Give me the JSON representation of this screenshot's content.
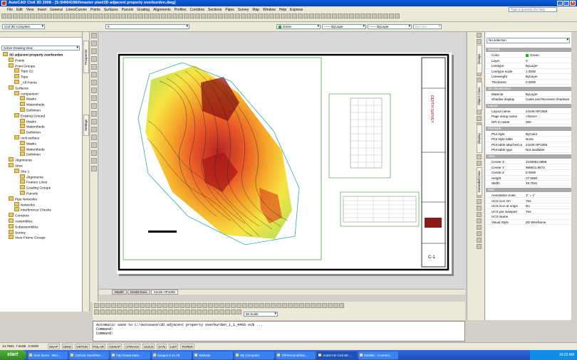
{
  "title": "AutoCAD Civil 3D 2008 - [S:\\04\\041960\\master plan\\3D adjacent property overburden.dwg]",
  "menu": [
    "File",
    "Edit",
    "View",
    "Insert",
    "General",
    "Lines/Curves",
    "Points",
    "Surfaces",
    "Parcels",
    "Grading",
    "Alignments",
    "Profiles",
    "Corridors",
    "Sections",
    "Pipes",
    "Survey",
    "Map",
    "Window",
    "Help",
    "Express"
  ],
  "search_placeholder": "Type a question for help",
  "toolbar": {
    "workspace": "Civil 3D Complete",
    "layer": "0",
    "color": "Green",
    "linetype": "ByLayer",
    "lineweight": "ByLayer",
    "plotstyle": "ByColor"
  },
  "prospector": {
    "vtab_label": "Prospector",
    "vtab2_label": "Settings",
    "view_select": "Active Drawing View",
    "tree": [
      {
        "label": "3D adjacent property overburden",
        "level": 0
      },
      {
        "label": "Points",
        "level": 1
      },
      {
        "label": "Point Groups",
        "level": 1
      },
      {
        "label": "Topo (1)",
        "level": 2
      },
      {
        "label": "Topo",
        "level": 2
      },
      {
        "label": "_All Points",
        "level": 2
      },
      {
        "label": "Surfaces",
        "level": 1
      },
      {
        "label": "comparison",
        "level": 2
      },
      {
        "label": "Masks",
        "level": 3
      },
      {
        "label": "Watersheds",
        "level": 3
      },
      {
        "label": "Definition",
        "level": 3
      },
      {
        "label": "Existing Ground",
        "level": 2
      },
      {
        "label": "Masks",
        "level": 3
      },
      {
        "label": "Watersheds",
        "level": 3
      },
      {
        "label": "Definition",
        "level": 3
      },
      {
        "label": "rock surface",
        "level": 2
      },
      {
        "label": "Masks",
        "level": 3
      },
      {
        "label": "Watersheds",
        "level": 3
      },
      {
        "label": "Definition",
        "level": 3
      },
      {
        "label": "Alignments",
        "level": 1
      },
      {
        "label": "Sites",
        "level": 1
      },
      {
        "label": "Site 1",
        "level": 2
      },
      {
        "label": "Alignments",
        "level": 3
      },
      {
        "label": "Feature Lines",
        "level": 3
      },
      {
        "label": "Grading Groups",
        "level": 3
      },
      {
        "label": "Parcels",
        "level": 3
      },
      {
        "label": "Pipe Networks",
        "level": 1
      },
      {
        "label": "Networks",
        "level": 2
      },
      {
        "label": "Interference Checks",
        "level": 2
      },
      {
        "label": "Corridors",
        "level": 1
      },
      {
        "label": "Assemblies",
        "level": 1
      },
      {
        "label": "Subassemblies",
        "level": 1
      },
      {
        "label": "Survey",
        "level": 1
      },
      {
        "label": "View Frame Groups",
        "level": 1
      }
    ]
  },
  "layout_tabs": [
    "Model",
    "24x36 Dxxx",
    "24x36 HP1055"
  ],
  "sheet": {
    "sheet_no": "C-1",
    "title_block_text": "DEPTH SURVEY"
  },
  "scale": "50 Scale",
  "command_lines": [
    "Automatic save to C:\\Autosave\\3D adjacent property overburden_1_1_4466.sv$ ...",
    "Command:",
    "Command:"
  ],
  "status": {
    "coords": "14.7581, 7.8188 , 0.0000",
    "toggles": [
      "SNAP",
      "GRID",
      "ORTHO",
      "POLAR",
      "OSNAP",
      "OTRACK",
      "DUCS",
      "DYN",
      "LWT",
      "PAPER"
    ]
  },
  "taskbar": {
    "start": "start",
    "tasks": [
      "Sent Items - Micr...",
      "Outlook Send/Rec...",
      "http://www.state...",
      "Images 5.31.08",
      "Website",
      "My Computer",
      "Ti\\Personnel\\Ele...",
      "AutoCAD Civil 3D ...",
      "MiniBlo - Connect..."
    ],
    "active_index": 7,
    "clock": "10:32 AM"
  },
  "properties": {
    "selection": "No selection",
    "tabs": [
      "Design",
      "Object Class",
      "Display",
      "Extended Data"
    ],
    "sections": [
      {
        "name": "General",
        "rows": [
          [
            "Color",
            "Green"
          ],
          [
            "Layer",
            "0"
          ],
          [
            "Linetype",
            "ByLayer"
          ],
          [
            "Linetype scale",
            "1.0000"
          ],
          [
            "Lineweight",
            "ByLayer"
          ],
          [
            "Thickness",
            "0.0000"
          ]
        ]
      },
      {
        "name": "3D Visualization",
        "rows": [
          [
            "Material",
            "ByLayer"
          ],
          [
            "Shadow display",
            "Casts and Receives Shadows"
          ]
        ]
      },
      {
        "name": "Layout",
        "rows": [
          [
            "Layout name",
            "24x36 HP1055"
          ],
          [
            "Page setup name",
            "<None>"
          ],
          [
            "DPI to raster",
            "300"
          ]
        ]
      },
      {
        "name": "Plot style",
        "rows": [
          [
            "Plot style",
            "ByColor"
          ],
          [
            "Plot style table",
            "None"
          ],
          [
            "Plot table attached to",
            "24x36 HP1055"
          ],
          [
            "Plot table type",
            "Not available"
          ]
        ]
      },
      {
        "name": "View",
        "rows": [
          [
            "Center X",
            "2193062.9858"
          ],
          [
            "Center Y",
            "968621.9572"
          ],
          [
            "Center Z",
            "0.0000"
          ],
          [
            "Height",
            "27.6584"
          ],
          [
            "Width",
            "49.7621"
          ]
        ]
      },
      {
        "name": "Misc",
        "rows": [
          [
            "Annotation scale",
            "1\" = 1'"
          ],
          [
            "UCS icon On",
            "Yes"
          ],
          [
            "UCS icon at origin",
            "No"
          ],
          [
            "UCS per viewport",
            "Yes"
          ],
          [
            "UCS Name",
            ""
          ],
          [
            "Visual Style",
            "2D Wireframe"
          ]
        ]
      }
    ]
  }
}
